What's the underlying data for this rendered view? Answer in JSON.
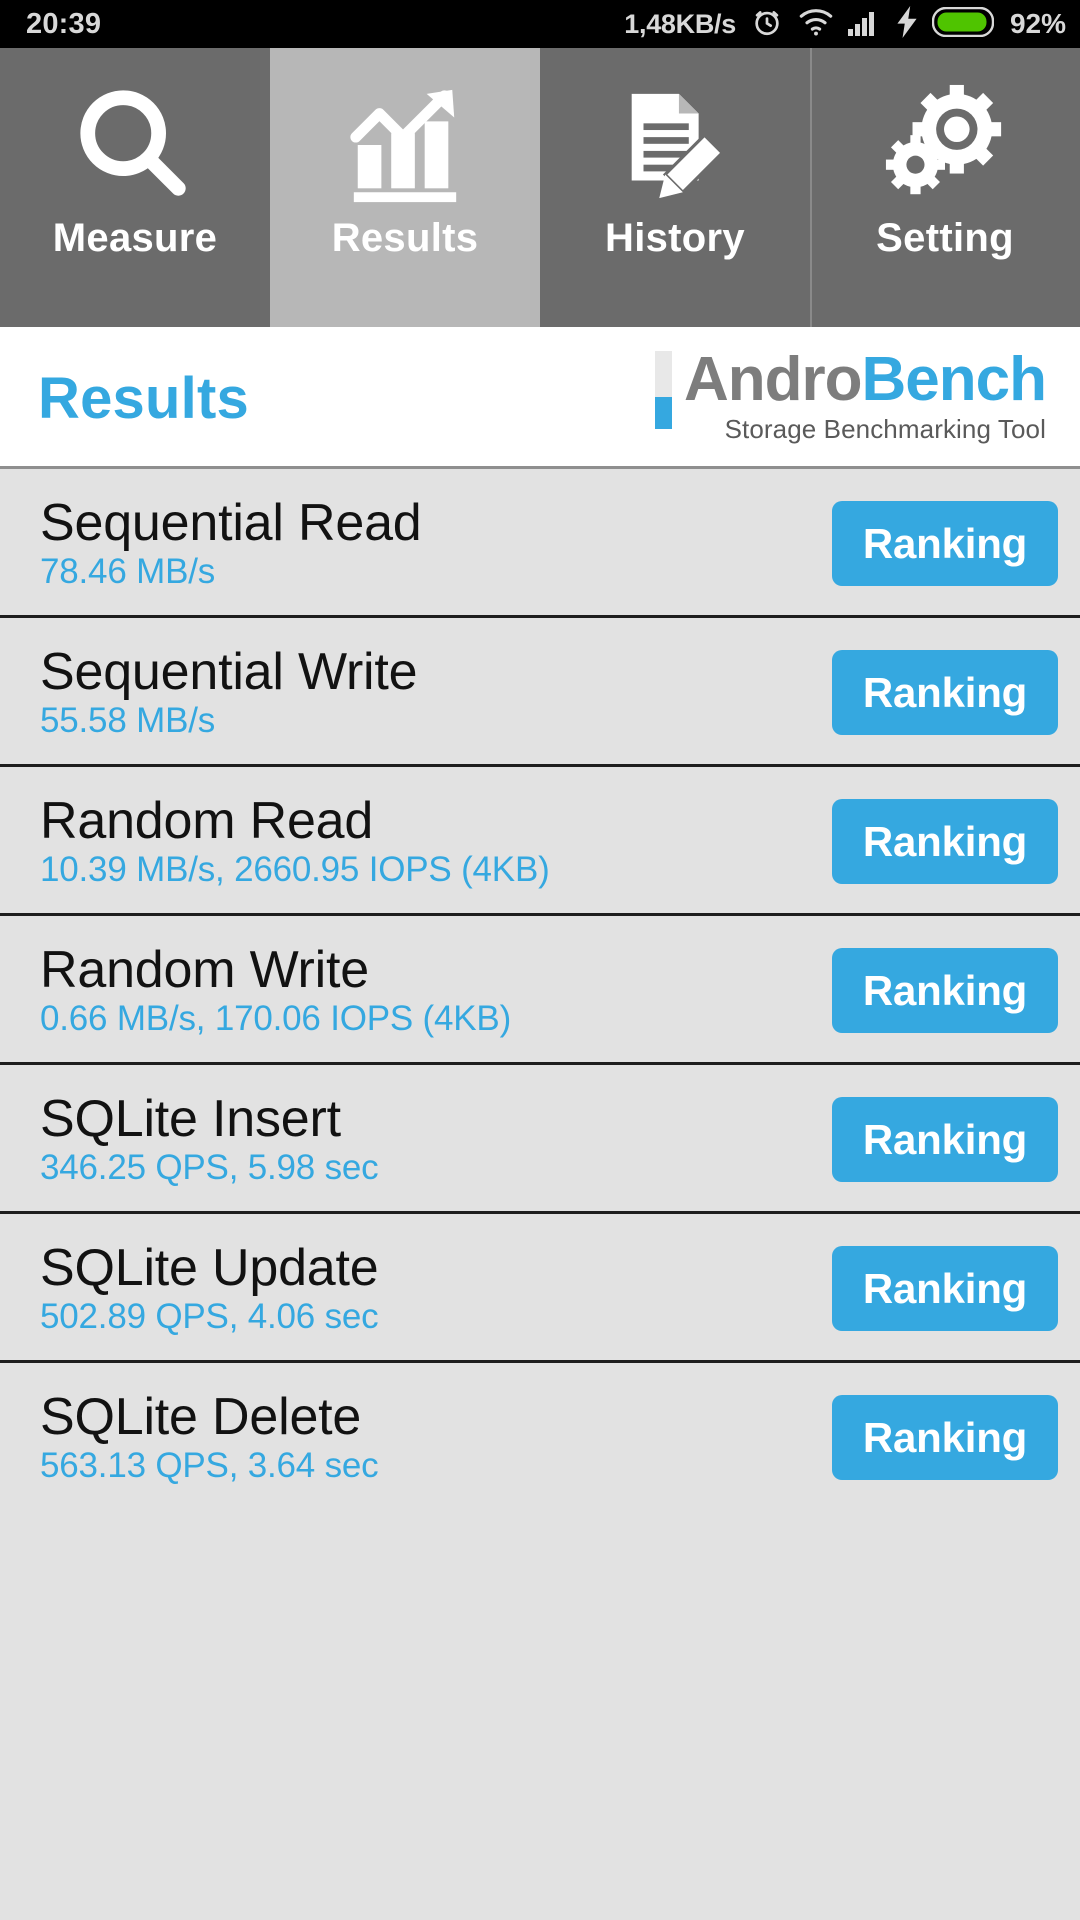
{
  "statusbar": {
    "time": "20:39",
    "network_speed": "1,48KB/s",
    "battery_percent": "92%",
    "icons": [
      "alarm-clock-icon",
      "wifi-icon",
      "signal-bars-icon",
      "charging-bolt-icon",
      "battery-icon"
    ]
  },
  "tabs": [
    {
      "label": "Measure",
      "icon": "magnifier-icon",
      "active": false
    },
    {
      "label": "Results",
      "icon": "bar-chart-arrow-icon",
      "active": true
    },
    {
      "label": "History",
      "icon": "document-pencil-icon",
      "active": false
    },
    {
      "label": "Setting",
      "icon": "gears-icon",
      "active": false
    }
  ],
  "header": {
    "title": "Results",
    "logo_primary": "Andro",
    "logo_secondary": "Bench",
    "logo_tagline": "Storage Benchmarking Tool"
  },
  "colors": {
    "accent": "#35a8e0",
    "tab_inactive": "#6b6b6b",
    "tab_active": "#b7b7b7",
    "list_bg": "#e2e2e2",
    "battery_green": "#4fc400"
  },
  "results": [
    {
      "name": "Sequential Read",
      "value": "78.46 MB/s",
      "button": "Ranking"
    },
    {
      "name": "Sequential Write",
      "value": "55.58 MB/s",
      "button": "Ranking"
    },
    {
      "name": "Random Read",
      "value": "10.39 MB/s, 2660.95 IOPS (4KB)",
      "button": "Ranking"
    },
    {
      "name": "Random Write",
      "value": "0.66 MB/s, 170.06 IOPS (4KB)",
      "button": "Ranking"
    },
    {
      "name": "SQLite Insert",
      "value": "346.25 QPS, 5.98 sec",
      "button": "Ranking"
    },
    {
      "name": "SQLite Update",
      "value": "502.89 QPS, 4.06 sec",
      "button": "Ranking"
    },
    {
      "name": "SQLite Delete",
      "value": "563.13 QPS, 3.64 sec",
      "button": "Ranking"
    }
  ]
}
